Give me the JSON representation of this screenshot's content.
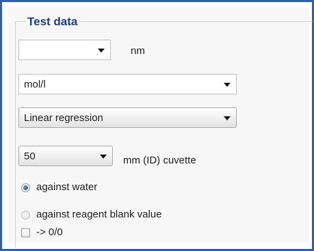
{
  "group": {
    "title": "Test data"
  },
  "wavelength": {
    "value": "",
    "unit": "nm"
  },
  "concentration_unit": {
    "value": "mol/l"
  },
  "evaluation": {
    "value": "Linear regression"
  },
  "cuvette": {
    "value": "50",
    "label": "mm (ID) cuvette"
  },
  "reference": {
    "options": [
      {
        "label": "against water",
        "selected": true
      },
      {
        "label": "against reagent blank value",
        "selected": false
      }
    ]
  },
  "origin_checkbox": {
    "label": "-> 0/0",
    "checked": false
  },
  "colors": {
    "frame_border": "#2f5fa8",
    "title": "#1f3f7a",
    "radio_selected": "#2a4f9c"
  }
}
